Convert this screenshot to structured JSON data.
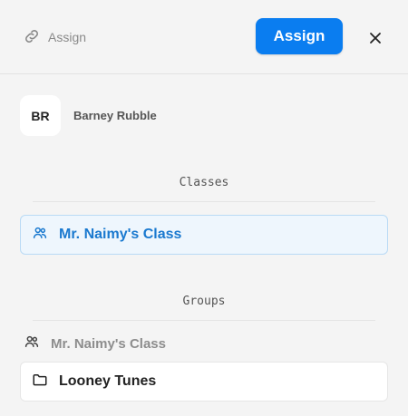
{
  "header": {
    "link_label": "Assign",
    "assign_button": "Assign",
    "close_icon": "close-icon",
    "link_icon": "link-icon"
  },
  "student": {
    "initials": "BR",
    "name": "Barney Rubble"
  },
  "classes": {
    "title": "Classes",
    "items": [
      {
        "label": "Mr. Naimy's Class",
        "icon": "users-icon",
        "selected": true
      }
    ]
  },
  "groups": {
    "title": "Groups",
    "parent": {
      "label": "Mr. Naimy's Class",
      "icon": "users-icon"
    },
    "items": [
      {
        "label": "Looney Tunes",
        "icon": "folder-icon"
      }
    ]
  },
  "colors": {
    "accent": "#0a7df0",
    "selected_text": "#1a79cf",
    "selected_bg": "#eef6fd",
    "background": "#f4f4f4"
  }
}
